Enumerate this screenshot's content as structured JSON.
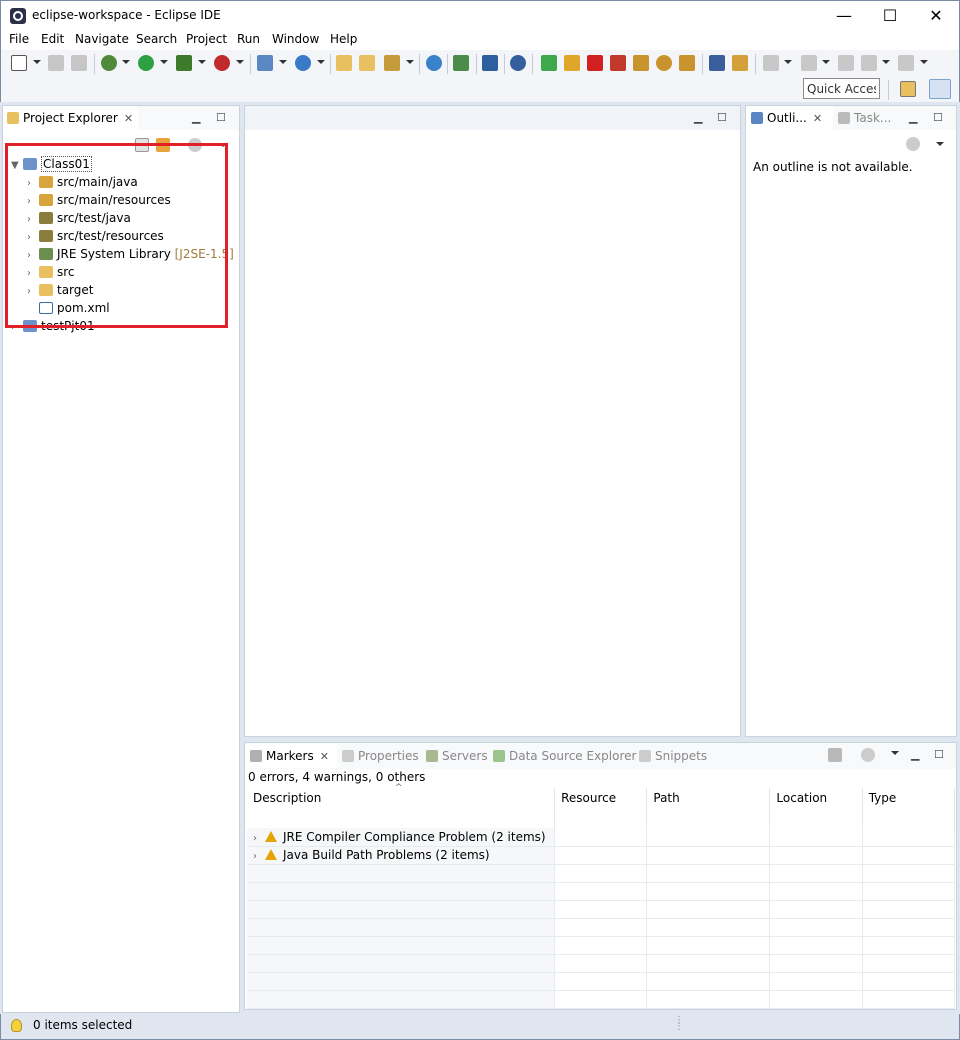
{
  "window": {
    "title": "eclipse-workspace - Eclipse IDE",
    "minimize": "—",
    "maximize": "☐",
    "close": "✕"
  },
  "menu": [
    "File",
    "Edit",
    "Navigate",
    "Search",
    "Project",
    "Run",
    "Window",
    "Help"
  ],
  "toolbar2": {
    "quick_access": "Quick Access"
  },
  "project_explorer": {
    "tab_label": "Project Explorer",
    "tree": [
      {
        "label": "Class01",
        "expanded": true
      },
      {
        "label": "src/main/java"
      },
      {
        "label": "src/main/resources"
      },
      {
        "label": "src/test/java"
      },
      {
        "label": "src/test/resources"
      },
      {
        "label": "JRE System Library",
        "suffix": "[J2SE-1.5]"
      },
      {
        "label": "src"
      },
      {
        "label": "target"
      },
      {
        "label": "pom.xml"
      },
      {
        "label": "testPjt01"
      }
    ]
  },
  "outline": {
    "tab_label": "Outli...",
    "tab2_label": "Task...",
    "message": "An outline is not available."
  },
  "bottom_panel": {
    "tabs": [
      "Markers",
      "Properties",
      "Servers",
      "Data Source Explorer",
      "Snippets"
    ],
    "summary": "0 errors, 4 warnings, 0 others",
    "columns": [
      "Description",
      "Resource",
      "Path",
      "Location",
      "Type"
    ],
    "rows": [
      "JRE Compiler Compliance Problem (2 items)",
      "Java Build Path Problems (2 items)"
    ]
  },
  "status_bar": {
    "text": "0 items selected"
  },
  "colors": {
    "accent": "#e2202a",
    "warning": "#e6a400"
  }
}
